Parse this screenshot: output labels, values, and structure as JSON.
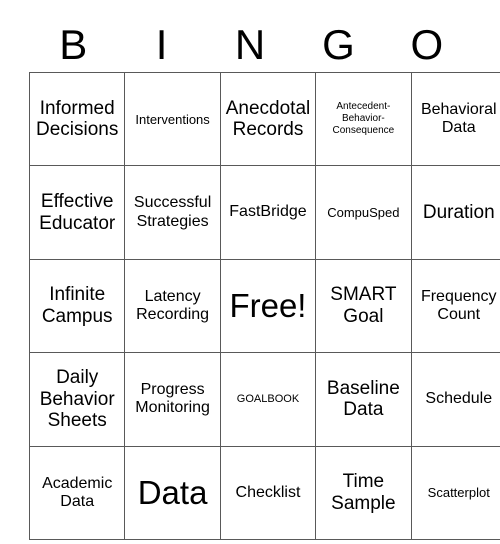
{
  "card": {
    "header_letters": [
      "B",
      "I",
      "N",
      "G",
      "O"
    ],
    "rows": [
      [
        {
          "text": "Informed Decisions",
          "size": "lg"
        },
        {
          "text": "Interventions",
          "size": "sm"
        },
        {
          "text": "Anecdotal Records",
          "size": "lg"
        },
        {
          "text": "Antecedent-Behavior-Consequence",
          "size": "xxs"
        },
        {
          "text": "Behavioral Data",
          "size": "md"
        }
      ],
      [
        {
          "text": "Effective Educator",
          "size": "lg"
        },
        {
          "text": "Successful Strategies",
          "size": "md"
        },
        {
          "text": "FastBridge",
          "size": "md"
        },
        {
          "text": "CompuSped",
          "size": "sm"
        },
        {
          "text": "Duration",
          "size": "lg"
        }
      ],
      [
        {
          "text": "Infinite Campus",
          "size": "lg"
        },
        {
          "text": "Latency Recording",
          "size": "md"
        },
        {
          "text": "Free!",
          "size": "xl"
        },
        {
          "text": "SMART Goal",
          "size": "lg"
        },
        {
          "text": "Frequency Count",
          "size": "md"
        }
      ],
      [
        {
          "text": "Daily Behavior Sheets",
          "size": "lg"
        },
        {
          "text": "Progress Monitoring",
          "size": "md"
        },
        {
          "text": "GOALBOOK",
          "size": "xs"
        },
        {
          "text": "Baseline Data",
          "size": "lg"
        },
        {
          "text": "Schedule",
          "size": "md"
        }
      ],
      [
        {
          "text": "Academic Data",
          "size": "md"
        },
        {
          "text": "Data",
          "size": "xl"
        },
        {
          "text": "Checklist",
          "size": "md"
        },
        {
          "text": "Time Sample",
          "size": "lg"
        },
        {
          "text": "Scatterplot",
          "size": "sm"
        }
      ]
    ]
  },
  "colors": {
    "background": "#ffffff",
    "text": "#000000",
    "grid_line": "#595959"
  }
}
